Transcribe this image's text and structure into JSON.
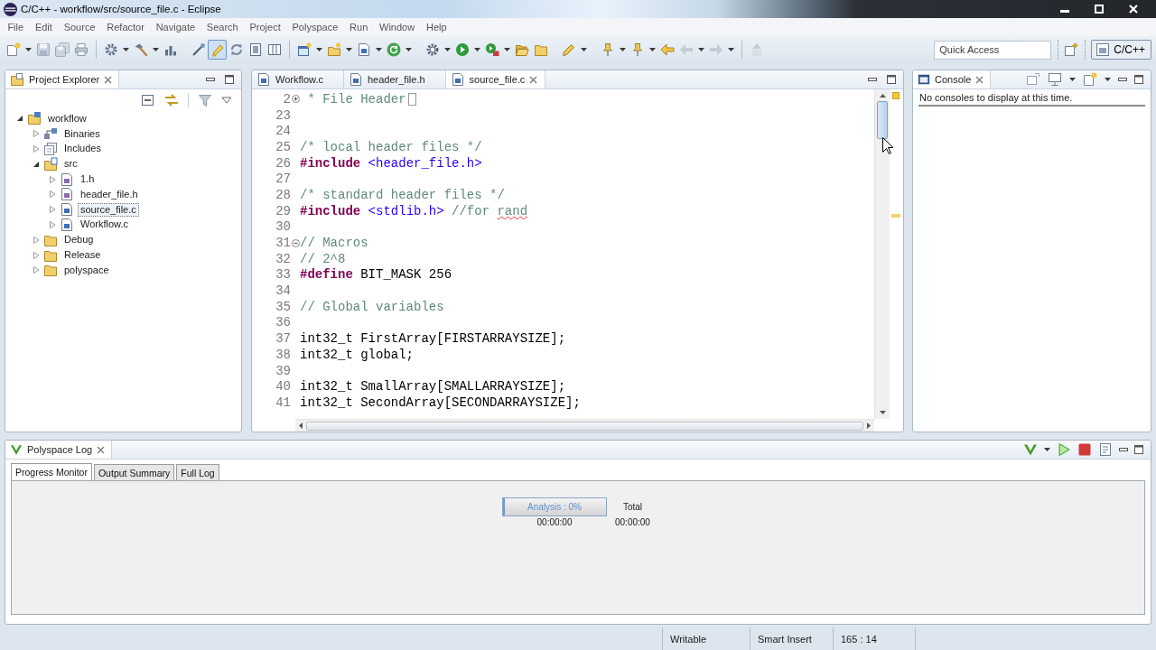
{
  "window": {
    "title": "C/C++ - workflow/src/source_file.c - Eclipse"
  },
  "menu": [
    "File",
    "Edit",
    "Source",
    "Refactor",
    "Navigate",
    "Search",
    "Project",
    "Polyspace",
    "Run",
    "Window",
    "Help"
  ],
  "toolbar": {
    "marker_toggle": {
      "pressed": true
    },
    "quick_access": {
      "placeholder": "Quick Access"
    },
    "perspectives": [
      {
        "label": "C/C++",
        "selected": true
      }
    ]
  },
  "project_explorer": {
    "title": "Project Explorer",
    "tree": [
      {
        "label": "workflow",
        "kind": "project",
        "expanded": true,
        "selected": false,
        "children": [
          {
            "label": "Binaries",
            "kind": "binaries",
            "expanded": false,
            "selected": false
          },
          {
            "label": "Includes",
            "kind": "includes",
            "expanded": false,
            "selected": false
          },
          {
            "label": "src",
            "kind": "source-folder",
            "expanded": true,
            "selected": false,
            "children": [
              {
                "label": "1.h",
                "kind": "header",
                "expanded": false,
                "selected": false
              },
              {
                "label": "header_file.h",
                "kind": "header",
                "expanded": false,
                "selected": false
              },
              {
                "label": "source_file.c",
                "kind": "source",
                "expanded": false,
                "selected": true
              },
              {
                "label": "Workflow.c",
                "kind": "source",
                "expanded": false,
                "selected": false
              }
            ]
          },
          {
            "label": "Debug",
            "kind": "folder",
            "expanded": false,
            "selected": false
          },
          {
            "label": "Release",
            "kind": "folder",
            "expanded": false,
            "selected": false
          },
          {
            "label": "polyspace",
            "kind": "folder",
            "expanded": false,
            "selected": false
          }
        ]
      }
    ]
  },
  "editor": {
    "tabs": [
      {
        "label": "Workflow.c",
        "selected": false
      },
      {
        "label": "header_file.h",
        "selected": false
      },
      {
        "label": "source_file.c",
        "selected": true
      }
    ],
    "lines": [
      {
        "number": "2",
        "fold": {
          "expanded": false
        },
        "parts": [
          {
            "kind": "comment",
            "text": " * File Header"
          }
        ]
      },
      {
        "number": "23"
      },
      {
        "number": "24"
      },
      {
        "number": "25",
        "parts": [
          {
            "kind": "comment",
            "text": "/* local header files */"
          }
        ]
      },
      {
        "number": "26",
        "parts": [
          {
            "kind": "directive",
            "text": "#include"
          },
          {
            "kind": "string",
            "text": " <header_file.h>"
          }
        ]
      },
      {
        "number": "27"
      },
      {
        "number": "28",
        "parts": [
          {
            "kind": "comment",
            "text": "/* standard header files */"
          }
        ]
      },
      {
        "number": "29",
        "parts": [
          {
            "kind": "directive",
            "text": "#include"
          },
          {
            "kind": "string",
            "text": " <stdlib.h>"
          },
          {
            "kind": "comment",
            "text": " //for "
          },
          {
            "kind": "misspelled",
            "text": "rand"
          }
        ]
      },
      {
        "number": "30"
      },
      {
        "number": "31",
        "fold": {
          "expanded": true
        },
        "parts": [
          {
            "kind": "comment",
            "text": "// Macros"
          }
        ]
      },
      {
        "number": "32",
        "parts": [
          {
            "kind": "comment",
            "text": "// 2^8"
          }
        ]
      },
      {
        "number": "33",
        "parts": [
          {
            "kind": "directive",
            "text": "#define"
          },
          {
            "kind": "code",
            "text": " BIT_MASK 256"
          }
        ]
      },
      {
        "number": "34"
      },
      {
        "number": "35",
        "parts": [
          {
            "kind": "comment",
            "text": "// Global variables"
          }
        ]
      },
      {
        "number": "36"
      },
      {
        "number": "37",
        "parts": [
          {
            "kind": "code",
            "text": "int32_t FirstArray[FIRSTARRAYSIZE];"
          }
        ]
      },
      {
        "number": "38",
        "parts": [
          {
            "kind": "code",
            "text": "int32_t global;"
          }
        ]
      },
      {
        "number": "39"
      },
      {
        "number": "40",
        "parts": [
          {
            "kind": "code",
            "text": "int32_t SmallArray[SMALLARRAYSIZE];"
          }
        ]
      },
      {
        "number": "41",
        "parts": [
          {
            "kind": "code",
            "text": "int32_t SecondArray[SECONDARRAYSIZE];"
          }
        ]
      }
    ]
  },
  "console": {
    "title": "Console",
    "message": "No consoles to display at this time."
  },
  "polyspace_log": {
    "title": "Polyspace Log",
    "tabs": [
      {
        "label": "Progress Monitor",
        "selected": true
      },
      {
        "label": "Output Summary",
        "selected": false
      },
      {
        "label": "Full Log",
        "selected": false
      }
    ],
    "progress": {
      "label": "Analysis : 0%",
      "level": 0,
      "elapsed": "00:00:00"
    },
    "total": {
      "label": "Total",
      "elapsed": "00:00:00"
    }
  },
  "status_bar": [
    "Writable",
    "Smart Insert",
    "165 : 14"
  ]
}
